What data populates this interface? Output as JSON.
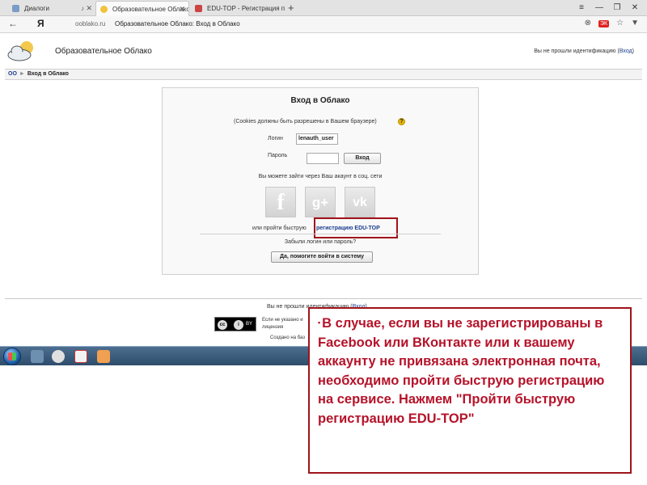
{
  "browser": {
    "tabs": [
      {
        "label": "Диалоги",
        "active": false
      },
      {
        "label": "Образовательное Облако",
        "active": true
      },
      {
        "label": "EDU-TOP - Регистрация по",
        "active": false
      }
    ],
    "new_tab": "+",
    "window_controls": [
      "≡",
      "—",
      "❐",
      "✕"
    ],
    "back": "←",
    "ya_logo": "Я",
    "url_domain": "ooblako.ru",
    "url_title": "Образовательное Облако: Вход в Облако",
    "addr_icons": [
      "⊗",
      "☆",
      "▼"
    ],
    "addr_badge": "ЭК"
  },
  "site": {
    "title": "Образовательное Облако",
    "login_status_prefix": "Вы не прошли идентификацию (",
    "login_link": "Вход",
    "login_status_suffix": ")",
    "breadcrumb": {
      "home": "ОО",
      "separator": "►",
      "current": "Вход в Облако"
    }
  },
  "loginbox": {
    "title": "Вход в Облако",
    "cookies_note": "(Cookies должны быть разрешены в Вашем браузере)",
    "help_glyph": "?",
    "login_label": "Логин",
    "login_value": "lenauth_user",
    "password_label": "Пароль",
    "enter_button": "Вход",
    "social_hint": "Вы можете зайти через Ваш акаунт в соц. сети",
    "social": {
      "facebook": "f",
      "googleplus": "g+",
      "vk": "vk"
    },
    "quick_reg_prefix": "или пройти быструю",
    "quick_reg_link": "регистрацию EDU-TOP",
    "forgot": "Забыли логин или пароль?",
    "help_button": "Да, помогите войти в систему"
  },
  "footer": {
    "login_status_prefix": "Вы не прошли идентификацию (",
    "login_link": "Вход",
    "login_status_suffix": ")",
    "cc_labels": [
      "cc",
      "i",
      "BY"
    ],
    "text_line_1": "Если не указано и",
    "text_line_2": "лицензия",
    "text_line_3": "Создано на баз"
  },
  "callout": {
    "bullet": "•",
    "text": "В случае, если вы не зарегистрированы в Facebook или ВКонтакте или к вашему аккаунту не привязана электронная почта, необходимо пройти быструю регистрацию на сервисе. Нажмем \"Пройти быструю регистрацию EDU-TOP\""
  },
  "colors": {
    "accent_red": "#a0141b",
    "link_blue": "#1a3d8f",
    "callout_text": "#b5132a"
  }
}
